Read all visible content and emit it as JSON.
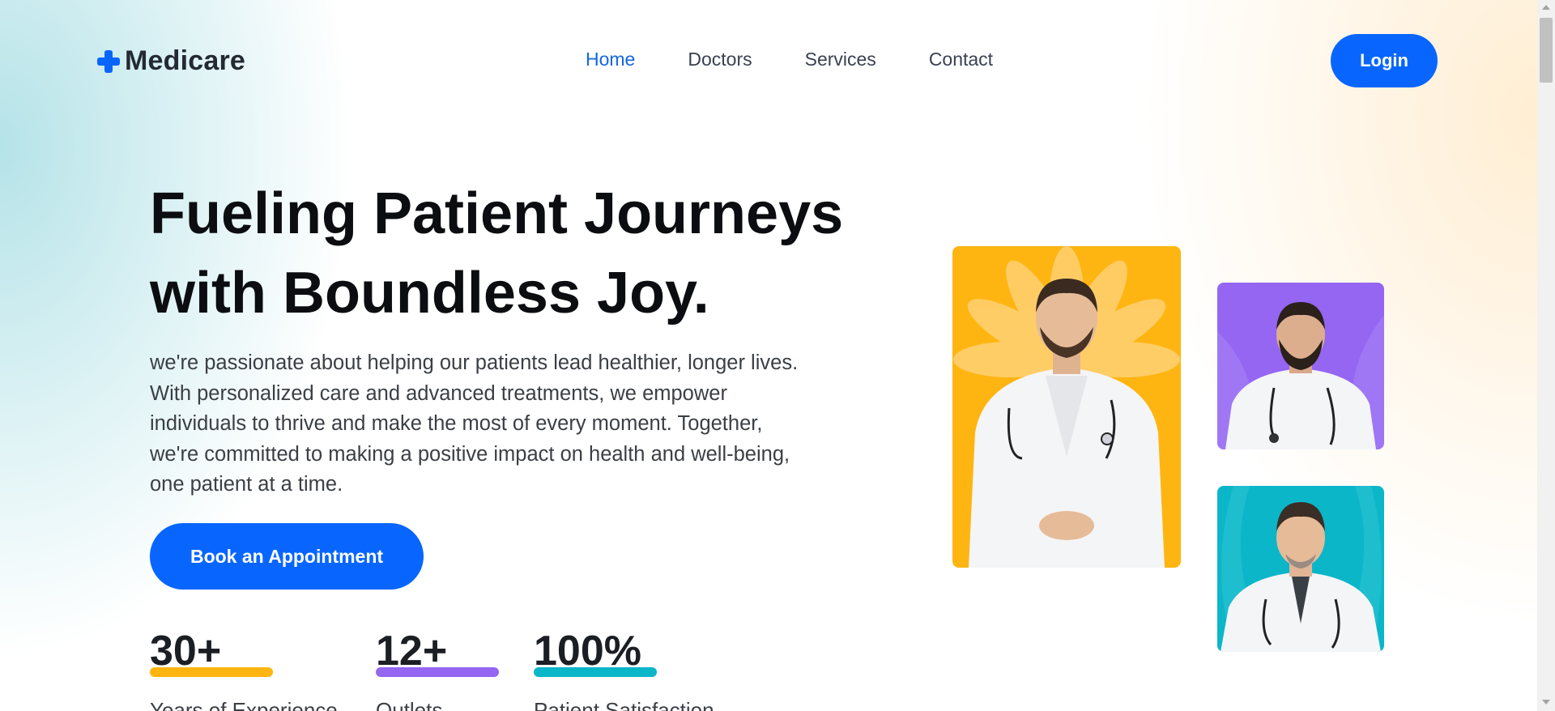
{
  "brand": {
    "name": "Medicare",
    "icon": "plus-icon",
    "color": "#0866ff"
  },
  "nav": {
    "items": [
      {
        "label": "Home",
        "active": true
      },
      {
        "label": "Doctors",
        "active": false
      },
      {
        "label": "Services",
        "active": false
      },
      {
        "label": "Contact",
        "active": false
      }
    ],
    "login_label": "Login"
  },
  "hero": {
    "title_line1": "Fueling Patient Journeys",
    "title_line2": "with Boundless Joy.",
    "description_lines": [
      "we're passionate about helping our patients lead healthier, longer lives.",
      "With personalized care and advanced treatments, we empower",
      "individuals to thrive and make the most of every moment. Together,",
      "we're committed to making a positive impact on health and well-being,",
      "one patient at a time."
    ],
    "cta_label": "Book an Appointment"
  },
  "stats": [
    {
      "value": "30+",
      "label": "Years of Experience",
      "color": "#ffb511"
    },
    {
      "value": "12+",
      "label": "Outlets",
      "color": "#9466f2"
    },
    {
      "value": "100%",
      "label": "Patient Satisfaction",
      "color": "#0bb6c9"
    }
  ],
  "images": [
    {
      "name": "doctor-photo-yellow",
      "background": "#ffb511"
    },
    {
      "name": "doctor-photo-purple",
      "background": "#9466f2"
    },
    {
      "name": "doctor-photo-teal",
      "background": "#0bb6c9"
    }
  ]
}
